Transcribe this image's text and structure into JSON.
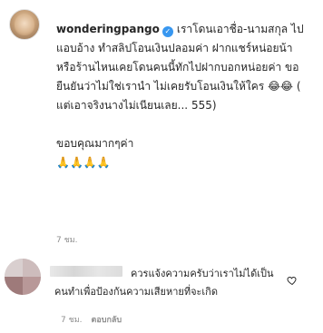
{
  "comment": {
    "username": "wonderingpango",
    "body": "เราโดนเอาชื่อ-นามสกุล ไปแอบอ้าง ทำสลิปโอนเงินปลอมค่า ฝากแชร์หน่อยน้า หรือร้านไหนเคยโดนคนนี้ทักไปฝากบอกหน่อยค่า ขอยืนยันว่าไม่ใช่เรานำ ไม่เคยรับโอนเงินให้ใคร 😂😂 ( แต่เอาจริงนางไม่เนียนเลย... 555)\n\nขอบคุณมากๆค่า\n🙏🙏🙏🙏",
    "time": "7 ชม."
  },
  "reply": {
    "body": "ควรแจ้งความครับว่าเราไม่ได้เป็นคนทำเพื่อป้องกันความเสียหายที่จะเกิด",
    "time": "7 ชม.",
    "reply_label": "ตอบกลับ"
  },
  "icons": {
    "verified": "verified-badge-icon",
    "heart": "heart-icon"
  },
  "colors": {
    "text": "#262626",
    "muted": "#8e8e8e",
    "verified": "#3897f0"
  }
}
